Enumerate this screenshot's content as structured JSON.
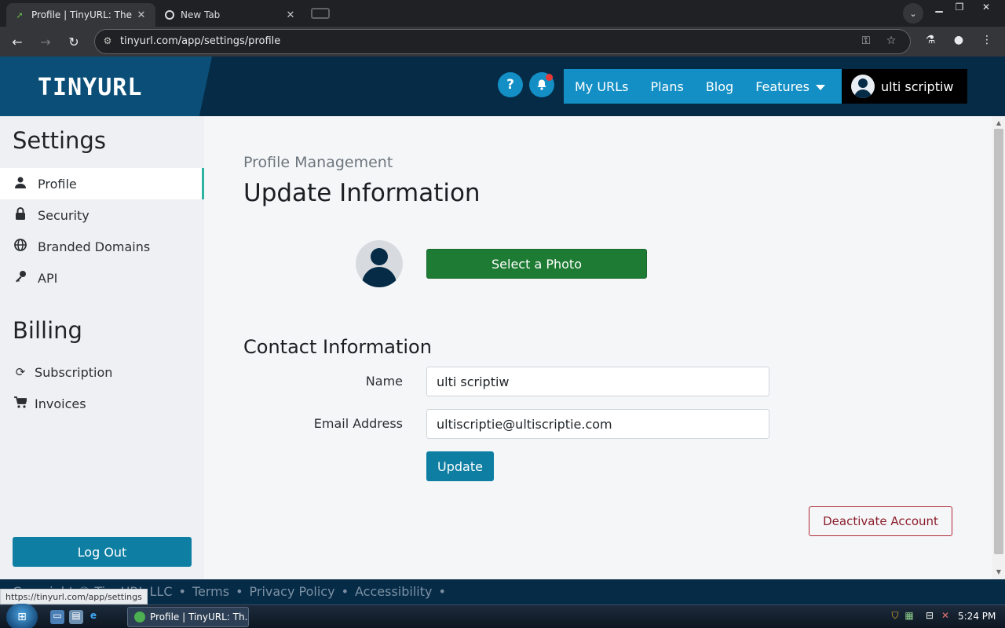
{
  "browser": {
    "tabs": [
      {
        "title": "Profile | TinyURL: The O",
        "favicon": "tinyurl-favicon"
      },
      {
        "title": "New Tab",
        "favicon": "chrome-icon"
      }
    ],
    "address": "tinyurl.com/app/settings/profile",
    "status_url": "https://tinyurl.com/app/settings"
  },
  "site": {
    "logo": "TINYURL",
    "help_label": "?",
    "nav": [
      {
        "label": "My URLs"
      },
      {
        "label": "Plans"
      },
      {
        "label": "Blog"
      },
      {
        "label": "Features"
      }
    ],
    "user_name": "ulti scriptiw"
  },
  "sidebar": {
    "settings_heading": "Settings",
    "settings_items": [
      {
        "label": "Profile",
        "icon": "user-icon",
        "active": true
      },
      {
        "label": "Security",
        "icon": "lock-icon"
      },
      {
        "label": "Branded Domains",
        "icon": "globe-icon"
      },
      {
        "label": "API",
        "icon": "key-icon"
      }
    ],
    "billing_heading": "Billing",
    "billing_items": [
      {
        "label": "Subscription",
        "icon": "refresh-icon"
      },
      {
        "label": "Invoices",
        "icon": "cart-icon"
      }
    ],
    "logout_label": "Log Out"
  },
  "main": {
    "subheading": "Profile Management",
    "title": "Update Information",
    "select_photo_label": "Select a Photo",
    "contact_heading": "Contact Information",
    "name_label": "Name",
    "name_value": "ulti scriptiw",
    "email_label": "Email Address",
    "email_value": "ultiscriptie@ultiscriptie.com",
    "update_label": "Update",
    "deactivate_label": "Deactivate Account"
  },
  "footer": {
    "copyright": "Copyright © TinyURL LLC",
    "links": [
      "Terms",
      "Privacy Policy",
      "Accessibility"
    ]
  },
  "taskbar": {
    "task_title": "Profile | TinyURL: Th...",
    "time": "5:24 PM"
  },
  "colors": {
    "header_bg": "#062b47",
    "nav_blue": "#138fc5",
    "primary_button": "#0f7ea3",
    "photo_button": "#1e7b34",
    "danger": "#b02a37"
  }
}
